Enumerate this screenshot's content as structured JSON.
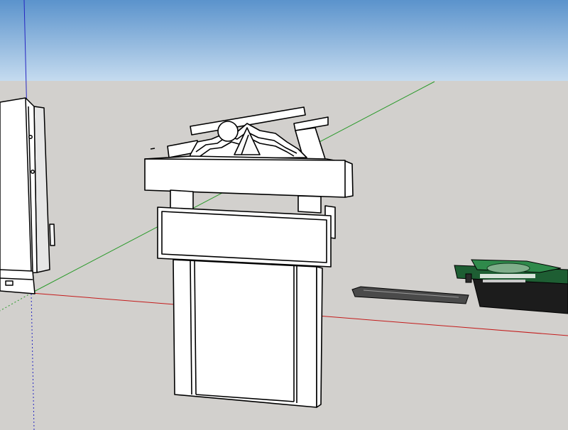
{
  "app": {
    "viewport": "sketchup-3d-viewport"
  },
  "scene": {
    "sky_top_color": "#5b93cc",
    "sky_bottom_color": "#c5dbef",
    "ground_color": "#d2d0cd",
    "axis_colors": {
      "red": "#c41b1b",
      "green": "#2a9a2a",
      "blue": "#2626c2"
    },
    "objects": [
      {
        "name": "monument-sign-model",
        "fill": "#ffffff",
        "edge": "#000000"
      },
      {
        "name": "partial-wall-model",
        "fill": "#ffffff",
        "edge": "#000000"
      },
      {
        "name": "green-sign-model",
        "fill": "#1e5e33",
        "edge": "#000000"
      },
      {
        "name": "shadow-plank",
        "fill": "#333333",
        "edge": "#000000"
      }
    ]
  }
}
